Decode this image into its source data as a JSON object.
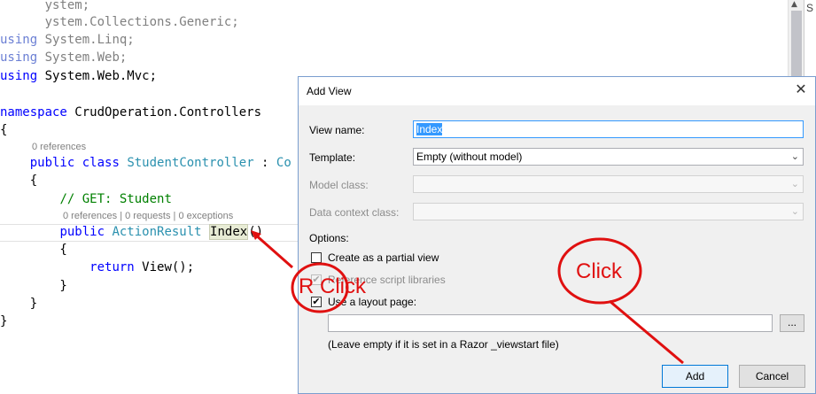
{
  "editor": {
    "lines": [
      {
        "segments": [
          {
            "text": "      ystem;",
            "cls": "dim"
          }
        ]
      },
      {
        "segments": [
          {
            "text": "      ystem.Collections.Generic;",
            "cls": "dim"
          }
        ]
      },
      {
        "segments": [
          {
            "text": "using",
            "cls": "kw dimkw"
          },
          {
            "text": " System.Linq;",
            "cls": "dim"
          }
        ]
      },
      {
        "segments": [
          {
            "text": "using",
            "cls": "kw dimkw"
          },
          {
            "text": " System.Web;",
            "cls": "dim"
          }
        ]
      },
      {
        "segments": [
          {
            "text": "using",
            "cls": "kw"
          },
          {
            "text": " System.Web.Mvc;",
            "cls": ""
          }
        ]
      },
      {
        "segments": [
          {
            "text": "",
            "cls": ""
          }
        ]
      },
      {
        "segments": [
          {
            "text": "namespace",
            "cls": "kw"
          },
          {
            "text": " CrudOperation.Controllers",
            "cls": ""
          }
        ]
      },
      {
        "segments": [
          {
            "text": "{",
            "cls": ""
          }
        ]
      },
      {
        "segments": [
          {
            "text": "    ",
            "cls": ""
          },
          {
            "text": "public",
            "cls": "kw"
          },
          {
            "text": " ",
            "cls": ""
          },
          {
            "text": "class",
            "cls": "kw"
          },
          {
            "text": " ",
            "cls": ""
          },
          {
            "text": "StudentController",
            "cls": "ty"
          },
          {
            "text": " : ",
            "cls": ""
          },
          {
            "text": "Co",
            "cls": "ty"
          }
        ]
      },
      {
        "segments": [
          {
            "text": "    {",
            "cls": ""
          }
        ]
      },
      {
        "segments": [
          {
            "text": "        ",
            "cls": ""
          },
          {
            "text": "// GET: Student",
            "cls": "cm"
          }
        ]
      },
      {
        "segments": [
          {
            "text": "        ",
            "cls": ""
          },
          {
            "text": "public",
            "cls": "kw"
          },
          {
            "text": " ",
            "cls": ""
          },
          {
            "text": "ActionResult",
            "cls": "ty"
          },
          {
            "text": " ",
            "cls": ""
          },
          {
            "text": "Index",
            "cls": "word-hl"
          },
          {
            "text": "()",
            "cls": ""
          }
        ]
      },
      {
        "segments": [
          {
            "text": "        {",
            "cls": ""
          }
        ]
      },
      {
        "segments": [
          {
            "text": "            ",
            "cls": ""
          },
          {
            "text": "return",
            "cls": "kw"
          },
          {
            "text": " View();",
            "cls": ""
          }
        ]
      },
      {
        "segments": [
          {
            "text": "        }",
            "cls": ""
          }
        ]
      },
      {
        "segments": [
          {
            "text": "    }",
            "cls": ""
          }
        ]
      },
      {
        "segments": [
          {
            "text": "}",
            "cls": ""
          }
        ]
      }
    ],
    "codelens_class": "0 references",
    "codelens_method": "0 references | 0 requests | 0 exceptions"
  },
  "right_strip_letter": "S",
  "dialog": {
    "title": "Add View",
    "close_glyph": "✕",
    "view_name_label": "View name:",
    "view_name_value": "Index",
    "template_label": "Template:",
    "template_value": "Empty (without model)",
    "model_class_label": "Model class:",
    "model_class_value": "",
    "data_context_label": "Data context class:",
    "data_context_value": "",
    "options_label": "Options:",
    "partial_view_label": "Create as a partial view",
    "partial_view_checked": false,
    "reference_scripts_label": "Reference script libraries",
    "reference_scripts_checked": true,
    "use_layout_label": "Use a layout page:",
    "use_layout_checked": true,
    "layout_path_value": "",
    "browse_label": "...",
    "layout_hint": "(Leave empty if it is set in a Razor _viewstart file)",
    "add_label": "Add",
    "cancel_label": "Cancel"
  },
  "annotations": {
    "right_click_text": "R Click",
    "click_text": "Click",
    "color": "#e01010"
  }
}
